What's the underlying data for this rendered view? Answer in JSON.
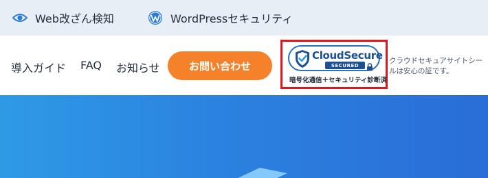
{
  "topbar": {
    "items": [
      {
        "label": "Web改ざん検知",
        "icon": "eye-icon"
      },
      {
        "label": "WordPressセキュリティ",
        "icon": "wordpress-icon"
      }
    ]
  },
  "nav": {
    "links": [
      "導入ガイド",
      "FAQ",
      "お知らせ"
    ],
    "contact_label": "お問い合わせ"
  },
  "seal": {
    "brand": "CloudSecure",
    "sub": "SECURED",
    "caption": "暗号化通信＋セキュリティ診断済",
    "note": "クラウドセキュアサイトシールは安心の証です。"
  },
  "colors": {
    "accent_orange": "#f5822b",
    "brand_blue": "#1c4f93",
    "highlight_red": "#e0161f",
    "hero_blue": "#2b82df",
    "topbar_bg": "#e8eef5"
  }
}
